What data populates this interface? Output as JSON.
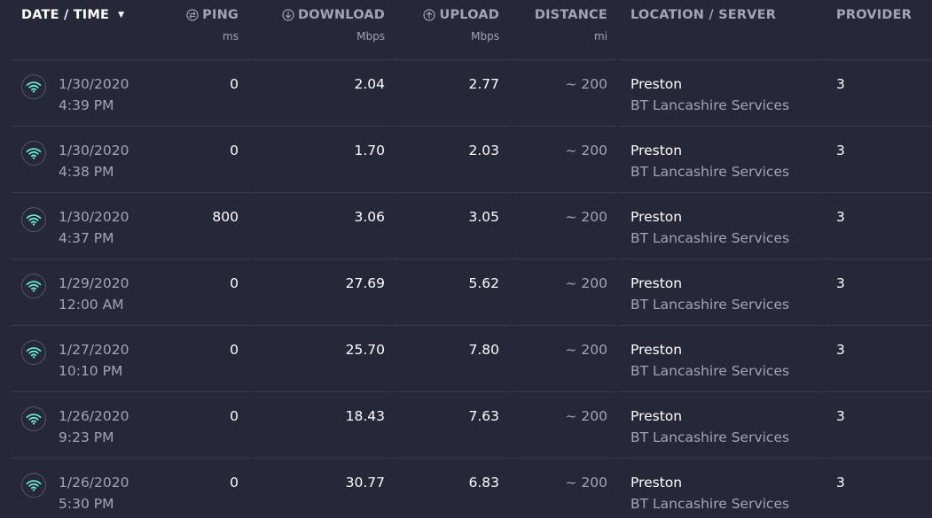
{
  "header": {
    "date_time": "DATE / TIME",
    "ping": {
      "label": "PING",
      "unit": "ms"
    },
    "download": {
      "label": "DOWNLOAD",
      "unit": "Mbps"
    },
    "upload": {
      "label": "UPLOAD",
      "unit": "Mbps"
    },
    "distance": {
      "label": "DISTANCE",
      "unit": "mi"
    },
    "location": "LOCATION / SERVER",
    "provider": "PROVIDER"
  },
  "colors": {
    "background": "#262739",
    "accent": "#6af4e0",
    "muted_text": "#a3a5b5",
    "divider": "#3a3c52"
  },
  "icons": {
    "row": "wifi-icon",
    "ping": "ping-icon",
    "download": "download-icon",
    "upload": "upload-icon",
    "sort": "sort-down-icon"
  },
  "rows": [
    {
      "date": "1/30/2020",
      "time": "4:39 PM",
      "ping": "0",
      "download": "2.04",
      "upload": "2.77",
      "distance": "~ 200",
      "location": "Preston",
      "server": "BT Lancashire Services",
      "provider": "3"
    },
    {
      "date": "1/30/2020",
      "time": "4:38 PM",
      "ping": "0",
      "download": "1.70",
      "upload": "2.03",
      "distance": "~ 200",
      "location": "Preston",
      "server": "BT Lancashire Services",
      "provider": "3"
    },
    {
      "date": "1/30/2020",
      "time": "4:37 PM",
      "ping": "800",
      "download": "3.06",
      "upload": "3.05",
      "distance": "~ 200",
      "location": "Preston",
      "server": "BT Lancashire Services",
      "provider": "3"
    },
    {
      "date": "1/29/2020",
      "time": "12:00 AM",
      "ping": "0",
      "download": "27.69",
      "upload": "5.62",
      "distance": "~ 200",
      "location": "Preston",
      "server": "BT Lancashire Services",
      "provider": "3"
    },
    {
      "date": "1/27/2020",
      "time": "10:10 PM",
      "ping": "0",
      "download": "25.70",
      "upload": "7.80",
      "distance": "~ 200",
      "location": "Preston",
      "server": "BT Lancashire Services",
      "provider": "3"
    },
    {
      "date": "1/26/2020",
      "time": "9:23 PM",
      "ping": "0",
      "download": "18.43",
      "upload": "7.63",
      "distance": "~ 200",
      "location": "Preston",
      "server": "BT Lancashire Services",
      "provider": "3"
    },
    {
      "date": "1/26/2020",
      "time": "5:30 PM",
      "ping": "0",
      "download": "30.77",
      "upload": "6.83",
      "distance": "~ 200",
      "location": "Preston",
      "server": "BT Lancashire Services",
      "provider": "3"
    }
  ]
}
